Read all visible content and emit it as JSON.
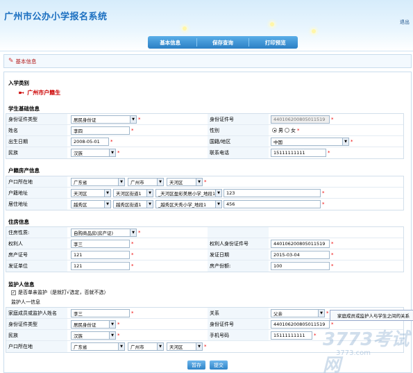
{
  "header": {
    "title": "广州市公办小学报名系统",
    "logout": "退出"
  },
  "nav": {
    "items": [
      "基本信息",
      "保存查询",
      "打印预览"
    ]
  },
  "section": {
    "title": "基本信息"
  },
  "enrollment": {
    "title": "入学类别",
    "type": "广州市户籍生"
  },
  "student": {
    "title": "学生基础信息",
    "id_type_label": "身份证件类型",
    "id_type_value": "居民身份证",
    "id_no_label": "身份证件号",
    "id_no_value": "440106200805011519",
    "name_label": "姓名",
    "name_value": "李四",
    "gender_label": "性别",
    "gender_male": "男",
    "gender_female": "女",
    "dob_label": "出生日期",
    "dob_value": "2008-05-01",
    "nation_label": "国籍/地区",
    "nation_value": "中国",
    "ethnic_label": "民族",
    "ethnic_value": "汉族",
    "phone_label": "联系电话",
    "phone_value": "15111111111"
  },
  "household": {
    "title": "户籍房产信息",
    "hukou_loc_label": "户口所在地",
    "province": "广东省",
    "city": "广州市",
    "district": "天河区",
    "hukou_addr_label": "户籍地址",
    "addr_district": "天河区",
    "addr_street": "天河区街道1",
    "addr_detail": "_天河区盈彩美居小学_地段1",
    "addr_no": "123",
    "res_addr_label": "居住地址",
    "res_district": "越秀区",
    "res_street": "越秀区街道1",
    "res_detail": "_越秀区天秀小学_地段1",
    "res_no": "456"
  },
  "housing": {
    "title": "住房信息",
    "nature_label": "住房性质:",
    "nature_value": "自购商品房(房产证)",
    "owner_label": "权利人",
    "owner_value": "李三",
    "owner_id_label": "权利人身份证件号",
    "owner_id_value": "440106200805011519",
    "cert_label": "房产证号",
    "cert_value": "121",
    "issue_date_label": "发证日期",
    "issue_date_value": "2015-03-04",
    "issuer_label": "发证单位",
    "issuer_value": "121",
    "share_label": "房产份额:",
    "share_value": "100"
  },
  "guardian": {
    "title": "监护人信息",
    "single_label": "是否单亲监护（是就打√选定，否就不选）",
    "sub_title": "监护人一信息",
    "name_label": "家庭成员或监护人姓名",
    "name_value": "李三",
    "relation_label": "关系",
    "relation_value": "父亲",
    "relation_tip": "家庭成员或监护人与学生之间的关系",
    "id_type_label": "身份证件类型",
    "id_type_value": "居民身份证",
    "id_no_label": "身份证件号",
    "id_no_value": "440106200805011519",
    "ethnic_label": "民族",
    "ethnic_value": "汉族",
    "mobile_label": "手机号码",
    "mobile_value": "15111111111",
    "hukou_label": "户口所在地",
    "province": "广东省",
    "city": "广州市",
    "district": "天河区"
  },
  "actions": {
    "save": "暂存",
    "submit": "提交"
  },
  "watermark": {
    "brand": "3773考试网",
    "url": "3773.com"
  },
  "colors": {
    "accent": "#1b6fc0",
    "required": "#e00000",
    "tab": "#2b7fc4"
  }
}
